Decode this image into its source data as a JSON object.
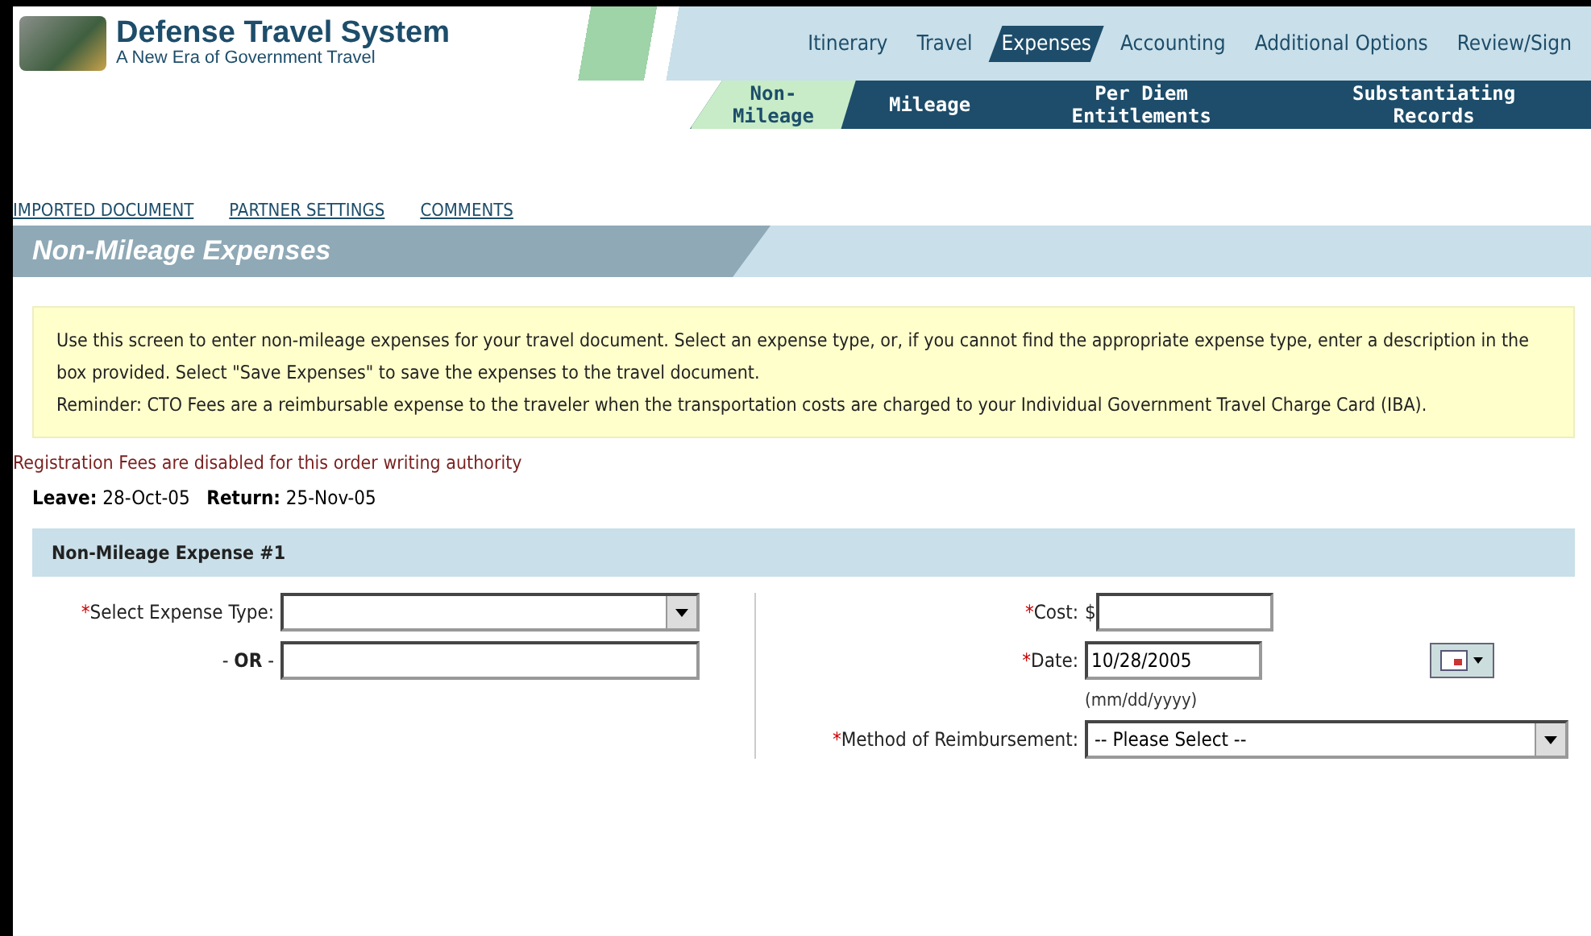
{
  "header": {
    "title": "Defense Travel System",
    "subtitle": "A New Era of Government Travel"
  },
  "tabs": [
    {
      "label": "Itinerary",
      "selected": false
    },
    {
      "label": "Travel",
      "selected": false
    },
    {
      "label": "Expenses",
      "selected": true
    },
    {
      "label": "Accounting",
      "selected": false
    },
    {
      "label": "Additional Options",
      "selected": false
    },
    {
      "label": "Review/Sign",
      "selected": false
    }
  ],
  "subtabs": [
    {
      "label": "Non-Mileage",
      "selected": true
    },
    {
      "label": "Mileage",
      "selected": false
    },
    {
      "label": "Per Diem Entitlements",
      "selected": false
    },
    {
      "label": "Substantiating Records",
      "selected": false
    }
  ],
  "links": [
    "IMPORTED DOCUMENT",
    "PARTNER SETTINGS",
    "COMMENTS"
  ],
  "page_title": "Non-Mileage Expenses",
  "info": [
    "Use this screen to enter non-mileage expenses for your travel document. Select an expense type, or, if you cannot find the appropriate expense type, enter a description in the box provided. Select \"Save Expenses\" to save the expenses to the travel document.",
    "Reminder: CTO Fees are a reimbursable expense to the traveler when the transportation costs are charged to your Individual Government Travel Charge Card (IBA)."
  ],
  "notice": "Registration Fees are disabled for this order writing authority",
  "trip": {
    "text": "**Leave:** 28-Oct-05   **Return:** 25-Nov-05"
  },
  "expense": {
    "title": "Non-Mileage Expense #1",
    "left": [
      {
        "kind": "select",
        "required": "*",
        "label": "Select Expense Type:"
      },
      {
        "kind": "text",
        "label": "- **OR** -"
      }
    ],
    "right": [
      {
        "kind": "money",
        "required": "*",
        "label": "Cost:",
        "prefix": "$"
      },
      {
        "kind": "date",
        "required": "*",
        "label": "Date:",
        "value": "10/28/2005",
        "hint": "(mm/dd/yyyy)"
      },
      {
        "kind": "select",
        "required": "*",
        "label": "Method of Reimbursement:",
        "value": "-- Please Select --"
      }
    ]
  }
}
